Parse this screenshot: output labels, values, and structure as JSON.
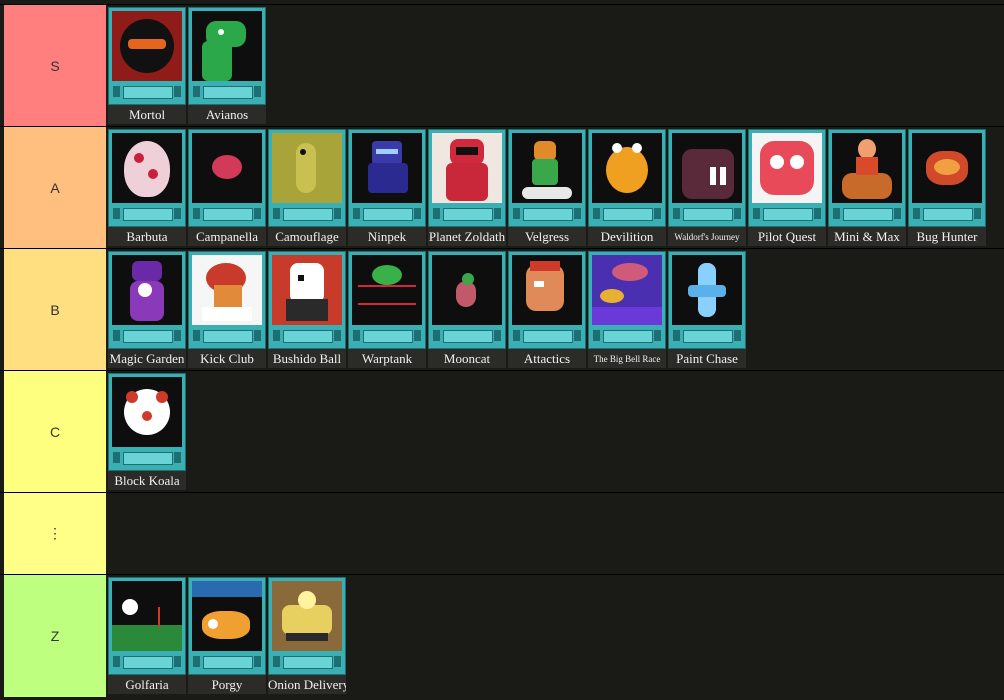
{
  "tiers": [
    {
      "label": "S",
      "color": "#ff7f7f",
      "games": [
        {
          "title": "Mortol",
          "art": "mortol-art",
          "bg": "#8f1c18"
        },
        {
          "title": "Avianos",
          "art": "dinosaur-art",
          "bg": "#0e0e0e"
        }
      ]
    },
    {
      "label": "A",
      "color": "#ffbf7f",
      "games": [
        {
          "title": "Barbuta",
          "art": "egg-art",
          "bg": "#0e0e0e"
        },
        {
          "title": "Campanella",
          "art": "orb-art",
          "bg": "#0e0e0e"
        },
        {
          "title": "Camouflage",
          "art": "chameleon-art",
          "bg": "#a9a43a"
        },
        {
          "title": "Ninpek",
          "art": "ninja-art",
          "bg": "#0e0e0e"
        },
        {
          "title": "Planet Zoldath",
          "art": "astronaut-art",
          "bg": "#f0e8e0"
        },
        {
          "title": "Velgress",
          "art": "runner-art",
          "bg": "#0e0e0e"
        },
        {
          "title": "Devilition",
          "art": "frog-art",
          "bg": "#0e0e0e"
        },
        {
          "title": "Waldorf's Journey",
          "art": "walrus-art",
          "bg": "#0e0e0e"
        },
        {
          "title": "Pilot Quest",
          "art": "pilot-art",
          "bg": "#f4f4f4"
        },
        {
          "title": "Mini & Max",
          "art": "rider-art",
          "bg": "#0e0e0e"
        },
        {
          "title": "Bug Hunter",
          "art": "bug-art",
          "bg": "#0e0e0e"
        }
      ]
    },
    {
      "label": "B",
      "color": "#ffdf7f",
      "games": [
        {
          "title": "Magic Garden",
          "art": "witch-art",
          "bg": "#0e0e0e"
        },
        {
          "title": "Kick Club",
          "art": "kicker-art",
          "bg": "#f6f6f6"
        },
        {
          "title": "Bushido Ball",
          "art": "samurai-art",
          "bg": "#c83a2a"
        },
        {
          "title": "Warptank",
          "art": "tank-art",
          "bg": "#0e0e0e"
        },
        {
          "title": "Mooncat",
          "art": "cat-art",
          "bg": "#0e0e0e"
        },
        {
          "title": "Attactics",
          "art": "warrior-art",
          "bg": "#0e0e0e"
        },
        {
          "title": "The Big Bell Race",
          "art": "ufo-art",
          "bg": "#4a2fb0"
        },
        {
          "title": "Paint Chase",
          "art": "racer-art",
          "bg": "#0e0e0e"
        }
      ]
    },
    {
      "label": "C",
      "color": "#ffff7f",
      "games": [
        {
          "title": "Block Koala",
          "art": "koala-art",
          "bg": "#0e0e0e"
        }
      ]
    },
    {
      "label": "⋮",
      "color": "#ffff88",
      "games": []
    },
    {
      "label": "Z",
      "color": "#bfff7f",
      "games": [
        {
          "title": "Golfaria",
          "art": "golf-art",
          "bg": "#0e0e0e"
        },
        {
          "title": "Porgy",
          "art": "submarine-art",
          "bg": "#0e0e0e"
        },
        {
          "title": "Onion Delivery",
          "art": "truck-art",
          "bg": "#8a6a3a"
        }
      ]
    }
  ]
}
